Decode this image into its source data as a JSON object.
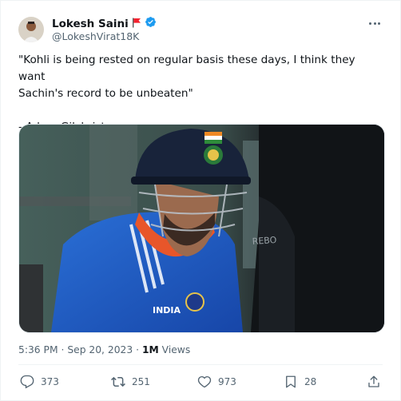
{
  "author": {
    "display_name": "Lokesh Saini",
    "handle": "@LokeshVirat18K",
    "verified": true,
    "flag_icon": "red-flag-icon"
  },
  "tweet": {
    "text_line1": "\"Kohli is being rested on regular basis these days, I think they want",
    "text_line2": "Sachin's record to be unbeaten\"",
    "attribution": "- Adam Gilchrist"
  },
  "media": {
    "type": "photo",
    "description_icon": "cricket-player-photo"
  },
  "meta": {
    "time": "5:36 PM",
    "separator": "·",
    "date": "Sep 20, 2023",
    "views_count": "1M",
    "views_label": "Views"
  },
  "actions": {
    "reply_count": "373",
    "retweet_count": "251",
    "like_count": "973",
    "bookmark_count": "28"
  },
  "colors": {
    "text_primary": "#0f1419",
    "text_secondary": "#536471",
    "verified_blue": "#1d9bf0",
    "flag_red": "#f4212e"
  }
}
